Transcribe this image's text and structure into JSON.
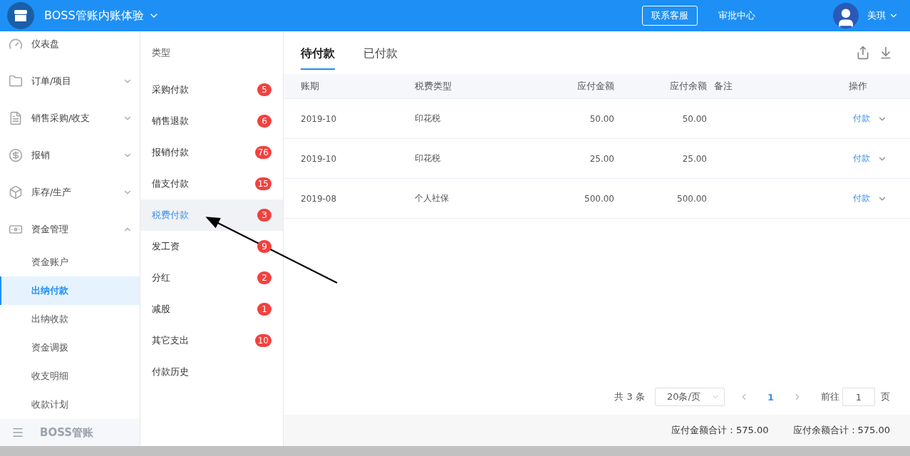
{
  "header": {
    "company": "BOSS管账内账体验",
    "buttons": [
      {
        "label": "联系客服",
        "kind": "outline"
      },
      {
        "label": "审批中心",
        "kind": "plain"
      }
    ],
    "user": "美琪"
  },
  "sidebar": {
    "items": [
      {
        "label": "仪表盘",
        "kind": "link"
      },
      {
        "label": "订单/项目",
        "kind": "group",
        "expanded": false
      },
      {
        "label": "销售采购/收支",
        "kind": "group",
        "expanded": false
      },
      {
        "label": "报销",
        "kind": "group",
        "expanded": false
      },
      {
        "label": "库存/生产",
        "kind": "group",
        "expanded": false
      },
      {
        "label": "资金管理",
        "kind": "group",
        "expanded": true,
        "children": [
          {
            "label": "资金账户",
            "selected": false
          },
          {
            "label": "出纳付款",
            "selected": true
          },
          {
            "label": "出纳收款",
            "selected": false
          },
          {
            "label": "资金调拨",
            "selected": false
          },
          {
            "label": "收支明细",
            "selected": false
          },
          {
            "label": "收款计划",
            "selected": false
          }
        ]
      }
    ],
    "footer": "BOSS管账"
  },
  "types": {
    "title": "类型",
    "items": [
      {
        "label": "采购付款",
        "count": "5",
        "selected": false
      },
      {
        "label": "销售退款",
        "count": "6",
        "selected": false
      },
      {
        "label": "报销付款",
        "count": "76",
        "selected": false
      },
      {
        "label": "借支付款",
        "count": "15",
        "selected": false
      },
      {
        "label": "税费付款",
        "count": "3",
        "selected": true
      },
      {
        "label": "发工资",
        "count": "9",
        "selected": false
      },
      {
        "label": "分红",
        "count": "2",
        "selected": false
      },
      {
        "label": "减股",
        "count": "1",
        "selected": false
      },
      {
        "label": "其它支出",
        "count": "10",
        "selected": false
      },
      {
        "label": "付款历史",
        "selected": false
      }
    ]
  },
  "tabs": [
    {
      "label": "待付款",
      "selected": true
    },
    {
      "label": "已付款",
      "selected": false
    }
  ],
  "table": {
    "columns": [
      "账期",
      "税费类型",
      "应付金额",
      "应付余额",
      "备注",
      "操作"
    ],
    "rows": [
      {
        "period": "2019-10",
        "type": "印花税",
        "amount": "50.00",
        "balance": "50.00",
        "action": "付款"
      },
      {
        "period": "2019-10",
        "type": "印花税",
        "amount": "25.00",
        "balance": "25.00",
        "action": "付款"
      },
      {
        "period": "2019-08",
        "type": "个人社保",
        "amount": "500.00",
        "balance": "500.00",
        "action": "付款"
      }
    ]
  },
  "pagination": {
    "total": "共 3 条",
    "page_size": "20条/页",
    "current": "1",
    "goto_label": "前往",
    "goto_value": "1",
    "page_label": "页"
  },
  "totals": [
    "应付金额合计：575.00",
    "应付余额合计：575.00"
  ]
}
